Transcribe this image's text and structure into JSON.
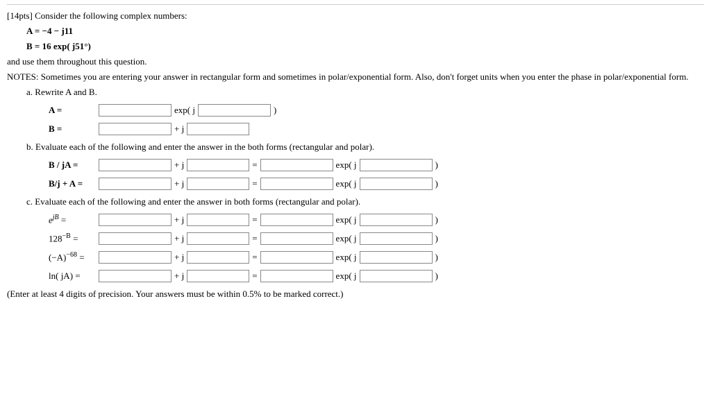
{
  "header": {
    "points": "[14pts]",
    "intro": "Consider the following complex numbers:",
    "defA_label": "A = ",
    "defA_value": "−4 − j11",
    "defB_label": "B = ",
    "defB_value": "16 exp( j51°)",
    "use_line": "and use them throughout this question.",
    "notes_label": "NOTES:",
    "notes_text": " Sometimes you are entering your answer in rectangular form and sometimes in polar/exponential form. Also, don't forget units when you enter the phase in polar/exponential form."
  },
  "part_a": {
    "title": "a. Rewrite A and B.",
    "A_lbl": "A =",
    "B_lbl": "B =",
    "exp_open": "exp( j",
    "plus_j": "+ j",
    "close_paren": ")"
  },
  "part_b": {
    "title": "b. Evaluate each of the following and enter the answer in the both forms (rectangular and polar).",
    "r1": "B / jA =",
    "r2": "B/j + A ="
  },
  "part_c": {
    "title": "c. Evaluate each of the following and enter the answer in both forms (rectangular and polar).",
    "r1_pre": "e",
    "r1_sup": "jB",
    "r1_eq": " =",
    "r2_pre": "128",
    "r2_sup": "−B",
    "r2_eq": " =",
    "r3_pre": "(−A)",
    "r3_sup": "−68",
    "r3_eq": " =",
    "r4": "ln( jA) ="
  },
  "common": {
    "plus_j": "+ j",
    "equals": "=",
    "exp_open": "exp( j",
    "close_paren": ")"
  },
  "footer": "(Enter at least 4 digits of precision. Your answers must be within 0.5% to be marked correct.)"
}
